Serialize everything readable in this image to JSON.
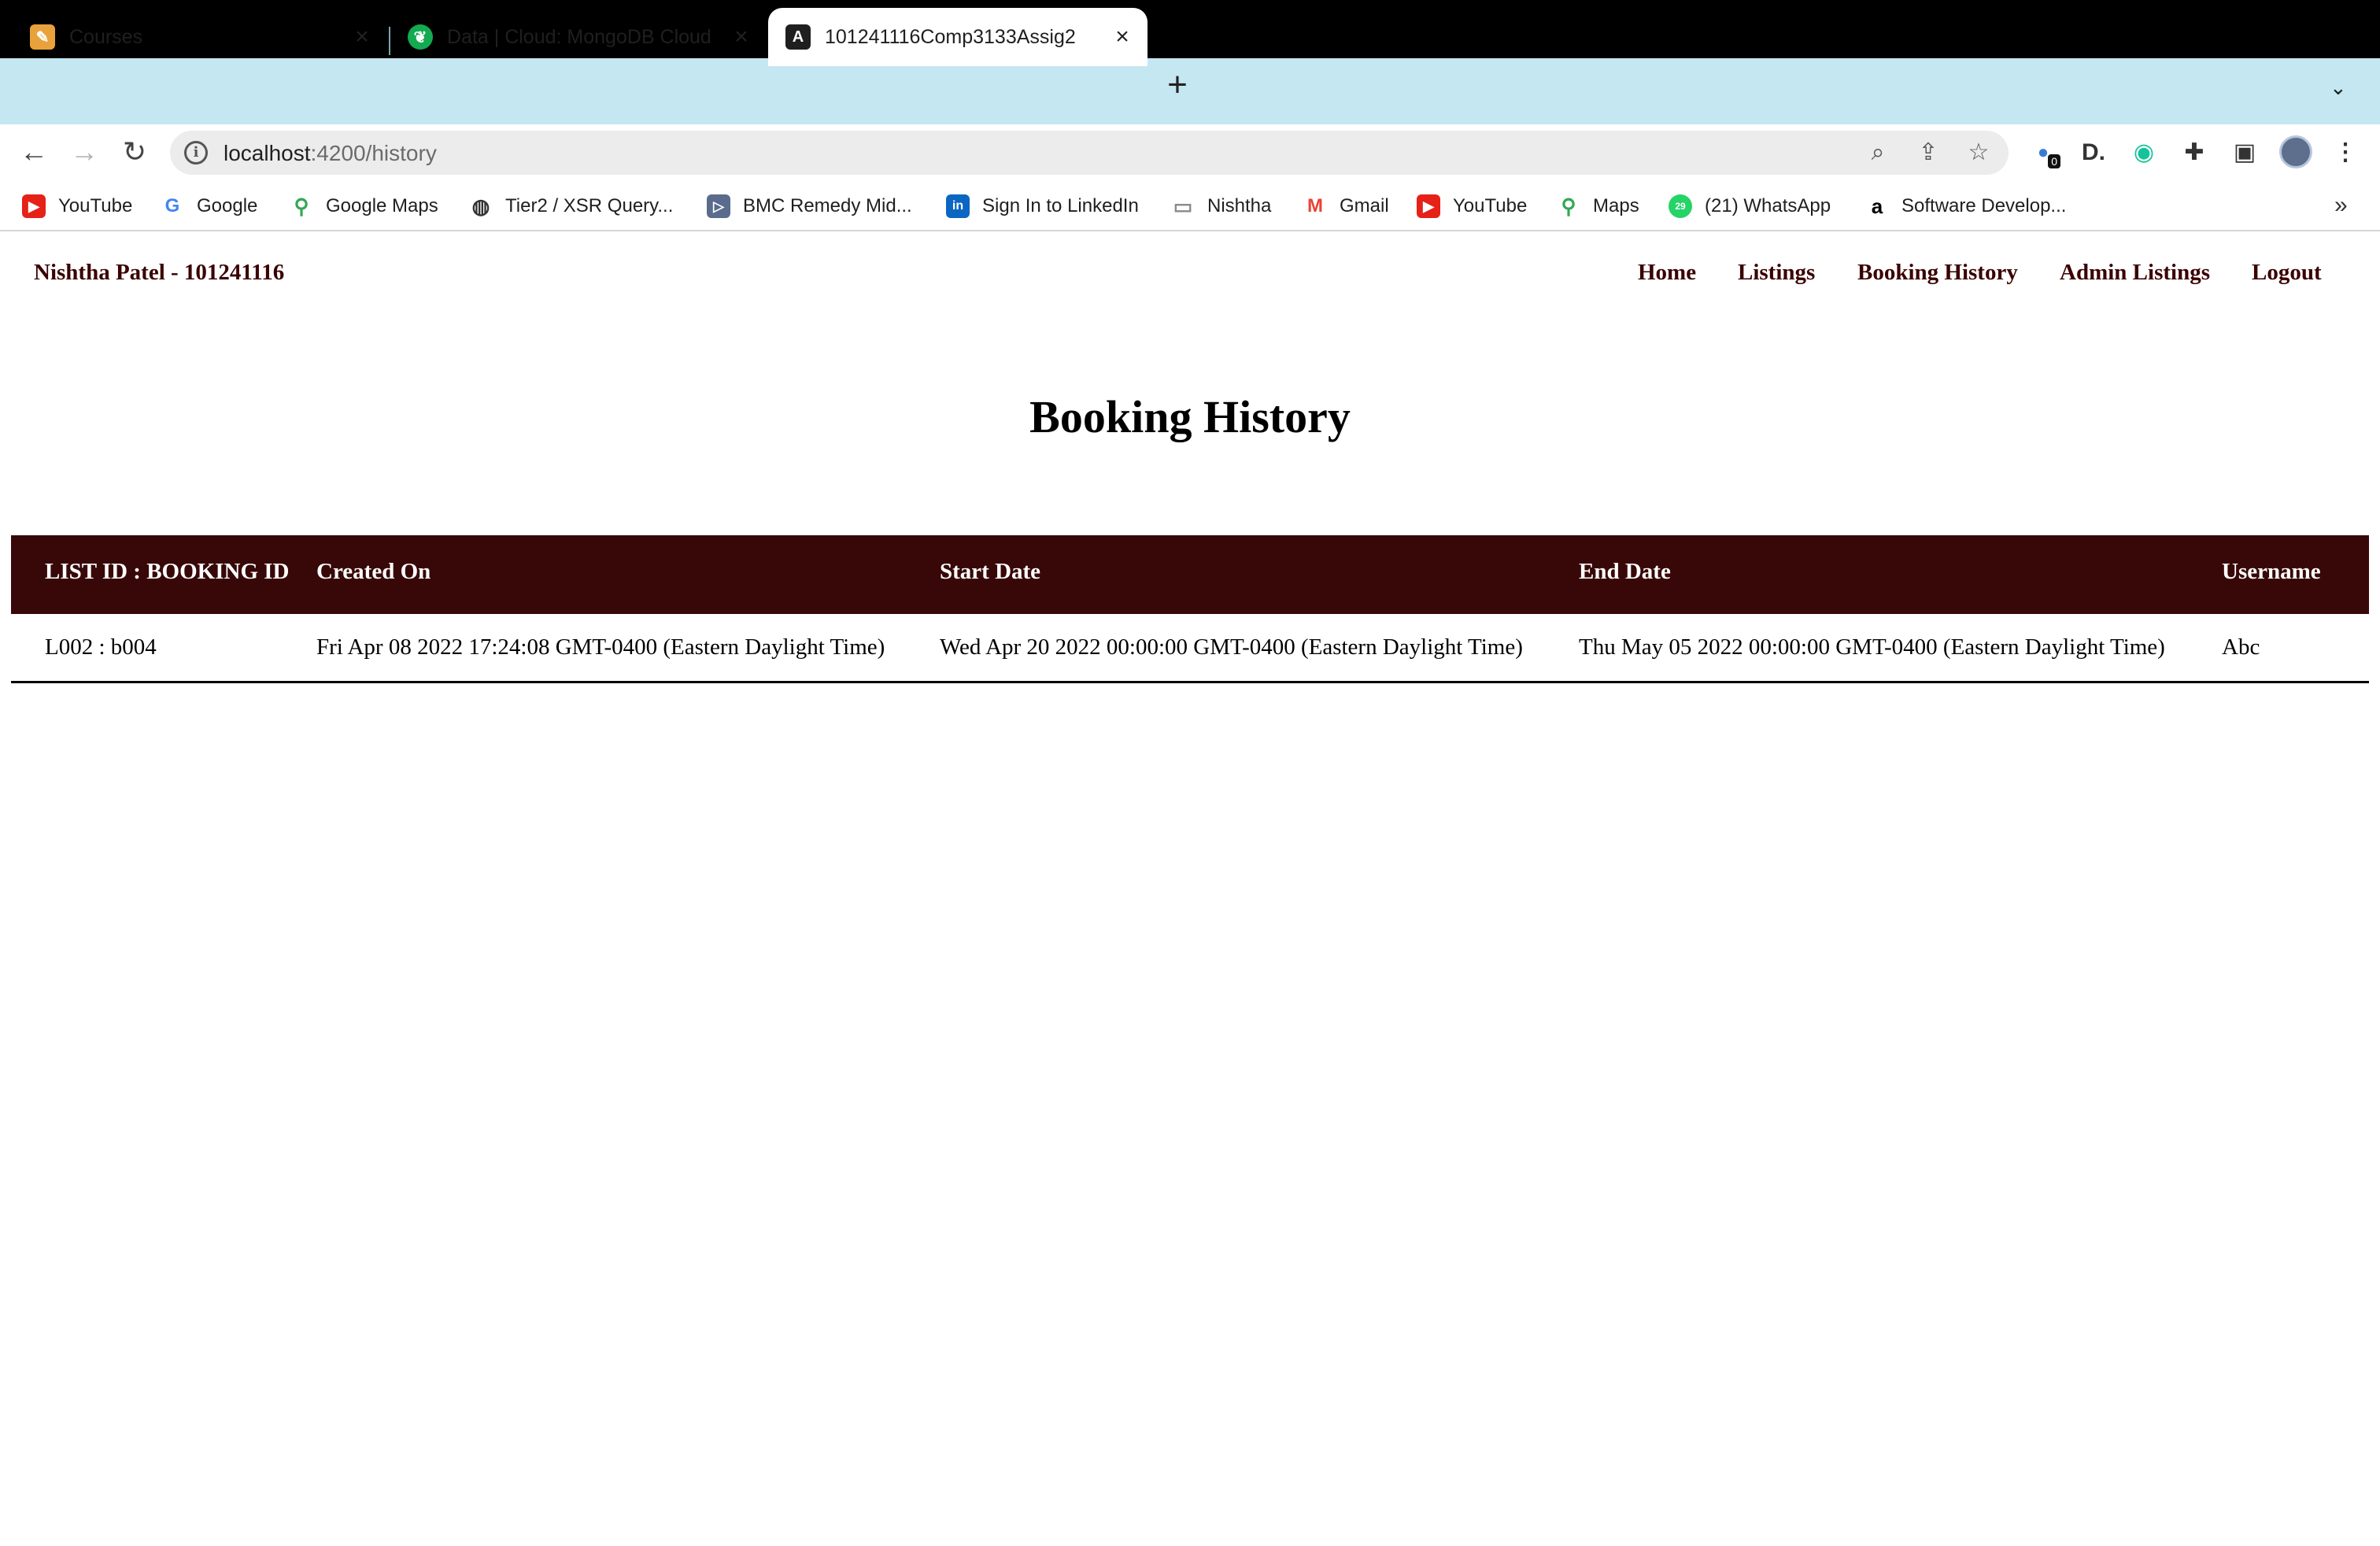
{
  "browser": {
    "tabs": [
      {
        "title": "Courses",
        "icon": "pencil-note-icon",
        "color": "#e9a23b"
      },
      {
        "title": "Data | Cloud: MongoDB Cloud",
        "icon": "mongodb-leaf-icon",
        "color": "#13aa52"
      },
      {
        "title": "101241116Comp3133Assig2",
        "icon": "angular-icon",
        "color": "#1f1f1f"
      }
    ],
    "url_host": "localhost",
    "url_path": ":4200/history",
    "extension_badge": "0",
    "bookmarks": [
      {
        "label": "YouTube",
        "icon": "youtube-icon",
        "color": "#e62117"
      },
      {
        "label": "Google",
        "icon": "google-icon",
        "color": "#4285f4"
      },
      {
        "label": "Google Maps",
        "icon": "maps-pin-icon",
        "color": "#34a853"
      },
      {
        "label": "Tier2 / XSR Query...",
        "icon": "globe-icon",
        "color": "#333333"
      },
      {
        "label": "BMC Remedy Mid...",
        "icon": "bmc-icon",
        "color": "#5a6b8c"
      },
      {
        "label": "Sign In to LinkedIn",
        "icon": "linkedin-icon",
        "color": "#0a66c2"
      },
      {
        "label": "Nishtha",
        "icon": "folder-icon",
        "color": "#8a8a8a"
      },
      {
        "label": "Gmail",
        "icon": "gmail-icon",
        "color": "#ea4335"
      },
      {
        "label": "YouTube",
        "icon": "youtube-icon",
        "color": "#e62117"
      },
      {
        "label": "Maps",
        "icon": "maps-pin-icon",
        "color": "#34a853"
      },
      {
        "label": "(21) WhatsApp",
        "icon": "whatsapp-icon",
        "color": "#25d366"
      },
      {
        "label": "Software Develop...",
        "icon": "amazon-icon",
        "color": "#000000"
      }
    ],
    "badge_count_whatsapp": "29"
  },
  "header": {
    "brand": "Nishtha Patel - 101241116",
    "nav": [
      "Home",
      "Listings",
      "Booking History",
      "Admin Listings",
      "Logout"
    ]
  },
  "main": {
    "title": "Booking History",
    "table": {
      "columns": [
        "LIST ID : BOOKING ID",
        "Created On",
        "Start Date",
        "End Date",
        "Username"
      ],
      "rows": [
        [
          "L002 : b004",
          "Fri Apr 08 2022 17:24:08 GMT-0400 (Eastern Daylight Time)",
          "Wed Apr 20 2022 00:00:00 GMT-0400 (Eastern Daylight Time)",
          "Thu May 05 2022 00:00:00 GMT-0400 (Eastern Daylight Time)",
          "Abc"
        ]
      ]
    }
  },
  "colors": {
    "accent": "#380808",
    "nav_text": "#3a0000",
    "tabstrip": "#c4e7f2"
  }
}
